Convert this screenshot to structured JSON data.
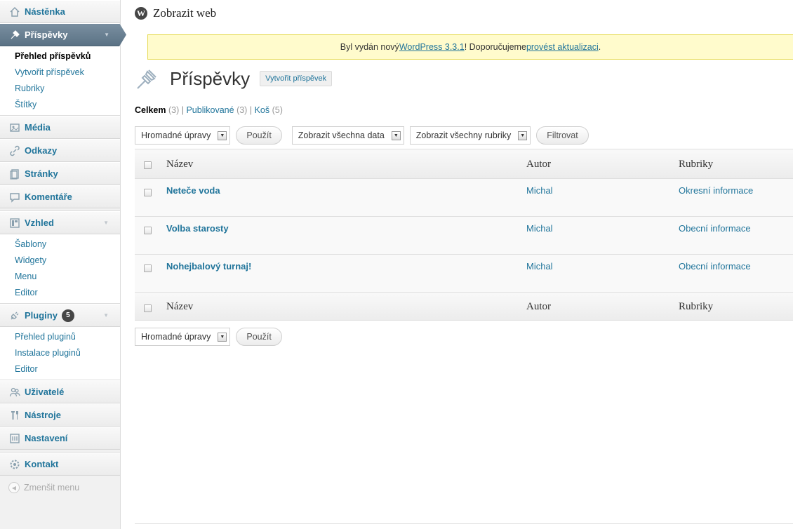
{
  "sidebar": {
    "dashboard": "Nástěnka",
    "posts": "Příspěvky",
    "posts_sub": [
      "Přehled příspěvků",
      "Vytvořit příspěvek",
      "Rubriky",
      "Štítky"
    ],
    "media": "Média",
    "links": "Odkazy",
    "pages": "Stránky",
    "comments": "Komentáře",
    "appearance": "Vzhled",
    "appearance_sub": [
      "Šablony",
      "Widgety",
      "Menu",
      "Editor"
    ],
    "plugins": "Pluginy",
    "plugins_badge": "5",
    "plugins_sub": [
      "Přehled pluginů",
      "Instalace pluginů",
      "Editor"
    ],
    "users": "Uživatelé",
    "tools": "Nástroje",
    "settings": "Nastavení",
    "contact": "Kontakt",
    "collapse": "Zmenšit menu"
  },
  "adminbar": {
    "site_link": "Zobrazit web"
  },
  "notice": {
    "before": "Byl vydán nový ",
    "link1": "WordPress 3.3.1",
    "middle": "! Doporučujeme ",
    "link2": "provést aktualizaci",
    "after": "."
  },
  "heading": {
    "title": "Příspěvky",
    "add_button": "Vytvořit příspěvek"
  },
  "filters": {
    "all": "Celkem",
    "all_count": "(3)",
    "published": "Publikované",
    "published_count": "(3)",
    "trash": "Koš",
    "trash_count": "(5)",
    "sep": "|"
  },
  "toolbar": {
    "bulk": "Hromadné úpravy",
    "apply": "Použít",
    "dates": "Zobrazit všechna data",
    "categories": "Zobrazit všechny rubriky",
    "filter": "Filtrovat"
  },
  "table": {
    "columns": [
      "Název",
      "Autor",
      "Rubriky"
    ],
    "rows": [
      {
        "title": "Neteče voda",
        "author": "Michal",
        "category": "Okresní informace"
      },
      {
        "title": "Volba starosty",
        "author": "Michal",
        "category": "Obecní informace"
      },
      {
        "title": "Nohejbalový turnaj!",
        "author": "Michal",
        "category": "Obecní informace"
      }
    ]
  }
}
